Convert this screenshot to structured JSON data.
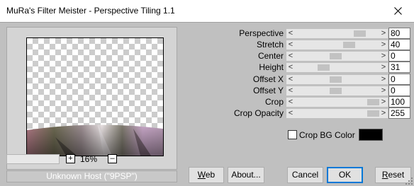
{
  "window": {
    "title": "MuRa's Filter Meister - Perspective Tiling 1.1"
  },
  "preview": {
    "zoom_plus": "+",
    "zoom_minus": "–",
    "zoom_value": "16%",
    "status_text": "Unknown Host (\"9PSP\")"
  },
  "parameters": [
    {
      "label": "Perspective",
      "value": "80"
    },
    {
      "label": "Stretch",
      "value": "40"
    },
    {
      "label": "Center",
      "value": "0"
    },
    {
      "label": "Height",
      "value": "31"
    },
    {
      "label": "Offset X",
      "value": "0"
    },
    {
      "label": "Offset Y",
      "value": "0"
    },
    {
      "label": "Crop",
      "value": "100"
    },
    {
      "label": "Crop Opacity",
      "value": "255"
    }
  ],
  "slider_arrows": {
    "left": "<",
    "right": ">"
  },
  "crop_bg": {
    "label": "Crop BG Color",
    "checked": false,
    "color": "#000000"
  },
  "buttons": {
    "web_first": "W",
    "web_rest": "eb",
    "about": "About...",
    "cancel": "Cancel",
    "ok": "OK",
    "reset_first": "R",
    "reset_rest": "eset"
  },
  "colors": {
    "client_bg": "#c0c0c0",
    "title_bg": "#ffffff",
    "default_button_border": "#0078d7"
  }
}
